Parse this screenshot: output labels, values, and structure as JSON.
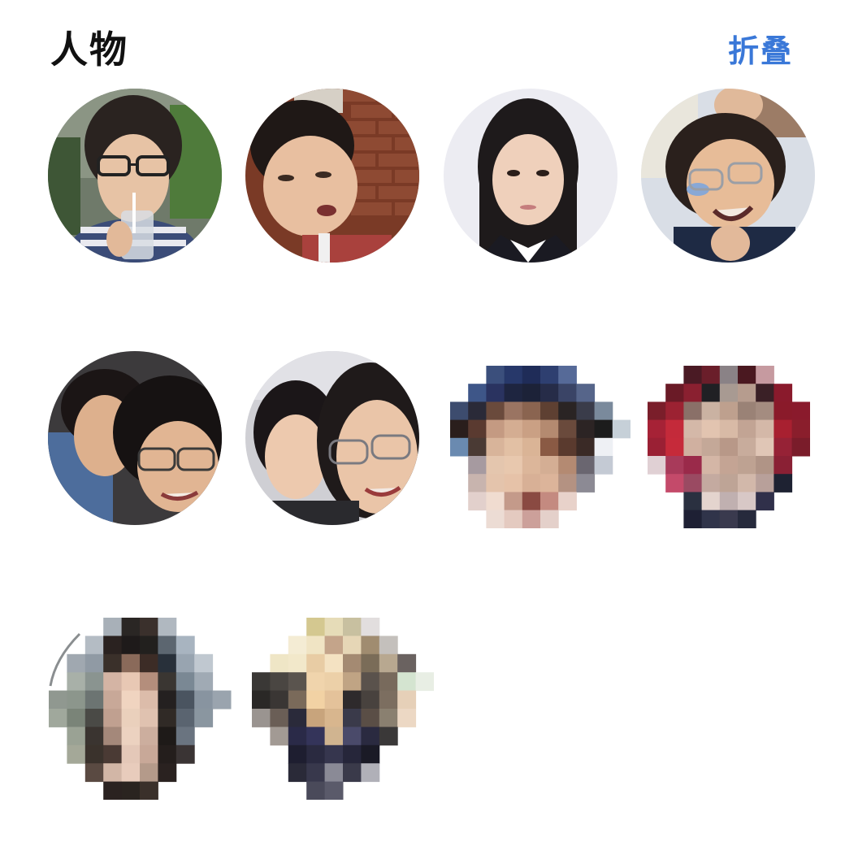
{
  "header": {
    "title": "人物",
    "collapse_label": "折叠"
  },
  "colors": {
    "accent": "#3a78d8",
    "title": "#111111",
    "background": "#ffffff"
  },
  "people": [
    {
      "id": "person-1",
      "photo_style": "clear"
    },
    {
      "id": "person-2",
      "photo_style": "clear"
    },
    {
      "id": "person-3",
      "photo_style": "clear"
    },
    {
      "id": "person-4",
      "photo_style": "clear"
    },
    {
      "id": "person-5",
      "photo_style": "clear"
    },
    {
      "id": "person-6",
      "photo_style": "clear"
    },
    {
      "id": "person-7",
      "photo_style": "pixelated"
    },
    {
      "id": "person-8",
      "photo_style": "pixelated"
    },
    {
      "id": "person-9",
      "photo_style": "pixelated"
    },
    {
      "id": "person-10",
      "photo_style": "pixelated"
    }
  ]
}
